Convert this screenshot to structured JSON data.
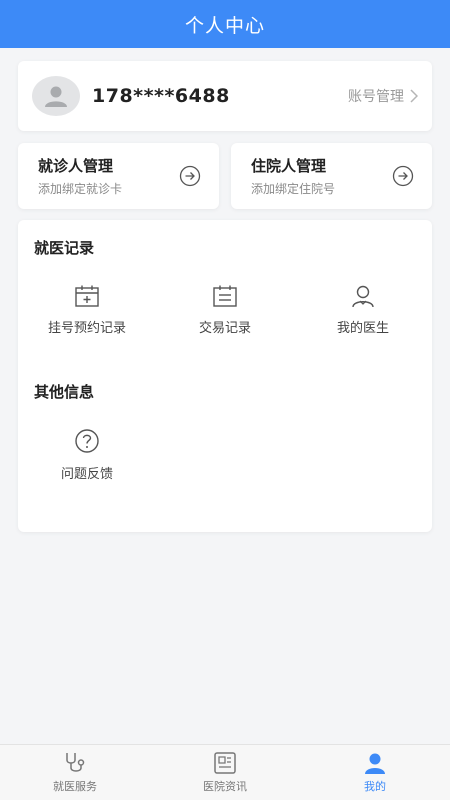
{
  "header": {
    "title": "个人中心"
  },
  "account": {
    "phone": "178****6488",
    "manage_label": "账号管理",
    "avatar_icon": "user-avatar-icon"
  },
  "patient_manage": {
    "title": "就诊人管理",
    "subtitle": "添加绑定就诊卡"
  },
  "inpatient_manage": {
    "title": "住院人管理",
    "subtitle": "添加绑定住院号"
  },
  "medical_records": {
    "title": "就医记录",
    "items": [
      {
        "label": "挂号预约记录",
        "icon": "calendar-icon"
      },
      {
        "label": "交易记录",
        "icon": "receipt-icon"
      },
      {
        "label": "我的医生",
        "icon": "doctor-icon"
      }
    ]
  },
  "other_info": {
    "title": "其他信息",
    "items": [
      {
        "label": "问题反馈",
        "icon": "question-icon"
      }
    ]
  },
  "tabbar": {
    "items": [
      {
        "label": "就医服务",
        "icon": "stethoscope-icon"
      },
      {
        "label": "医院资讯",
        "icon": "news-icon"
      },
      {
        "label": "我的",
        "icon": "profile-icon"
      }
    ]
  },
  "colors": {
    "primary": "#3d8af7",
    "background": "#f4f5f7",
    "text": "#222222",
    "muted": "#999999"
  }
}
